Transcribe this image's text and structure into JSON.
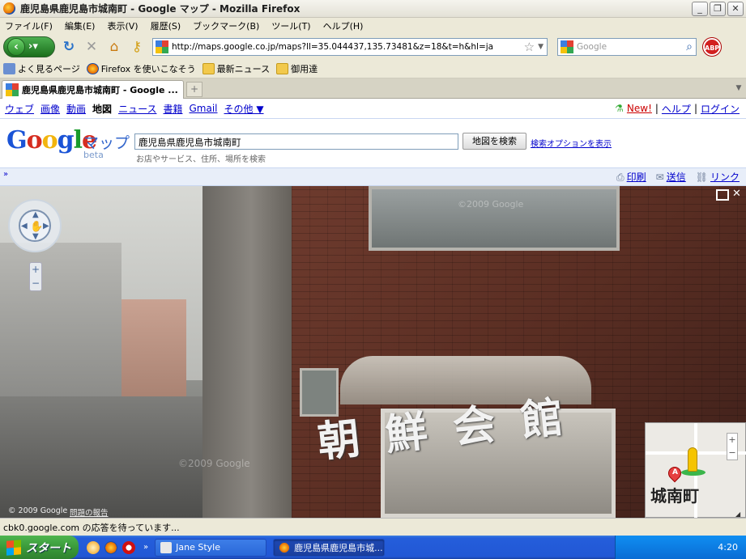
{
  "window": {
    "title": "鹿児島県鹿児島市城南町 - Google マップ - Mozilla Firefox",
    "buttons": {
      "minimize": "_",
      "restore": "❐",
      "close": "✕"
    }
  },
  "menu": [
    "ファイル(F)",
    "編集(E)",
    "表示(V)",
    "履歴(S)",
    "ブックマーク(B)",
    "ツール(T)",
    "ヘルプ(H)"
  ],
  "toolbar": {
    "url": "http://maps.google.co.jp/maps?ll=35.044437,135.73481&z=18&t=h&hl=ja",
    "search_placeholder": "Google",
    "abp": "ABP"
  },
  "bookmarks": [
    "よく見るページ",
    "Firefox を使いこなそう",
    "最新ニュース",
    "御用達"
  ],
  "tabs": [
    {
      "label": "鹿児島県鹿児島市城南町 - Google ..."
    }
  ],
  "google_nav": {
    "links": [
      "ウェブ",
      "画像",
      "動画",
      "地図",
      "ニュース",
      "書籍",
      "Gmail",
      "その他 ▼"
    ],
    "current": "地図",
    "new_label": "New!",
    "help": "ヘルプ",
    "login": "ログイン"
  },
  "maps_header": {
    "logo_letters": [
      "G",
      "o",
      "o",
      "g",
      "l",
      "e"
    ],
    "product": "マップ",
    "beta": "beta",
    "query": "鹿児島県鹿児島市城南町",
    "search_button": "地図を検索",
    "options_link": "検索オプションを表示",
    "hint": "お店やサービス、住所、場所を検索"
  },
  "map_toolbar": {
    "print": "印刷",
    "send": "送信",
    "link": "リンク"
  },
  "streetview": {
    "sign": "朝鮮会館",
    "watermark": "©2009 Google",
    "copyright": "© 2009 Google",
    "report": "問題の報告",
    "minimap_label": "城南町",
    "marker_letter": "A"
  },
  "status": "cbk0.google.com の応答を待っています...",
  "taskbar": {
    "start": "スタート",
    "items": [
      "Jane Style",
      "鹿児島県鹿児島市城..."
    ],
    "clock": "4:20"
  },
  "colors": {
    "link": "#0000cc",
    "google_blue": "#1a53d6",
    "google_red": "#d62d20",
    "google_yellow": "#f2b50f",
    "google_green": "#189b2b",
    "xp_blue": "#245edb",
    "xp_green": "#3a9a3a"
  }
}
